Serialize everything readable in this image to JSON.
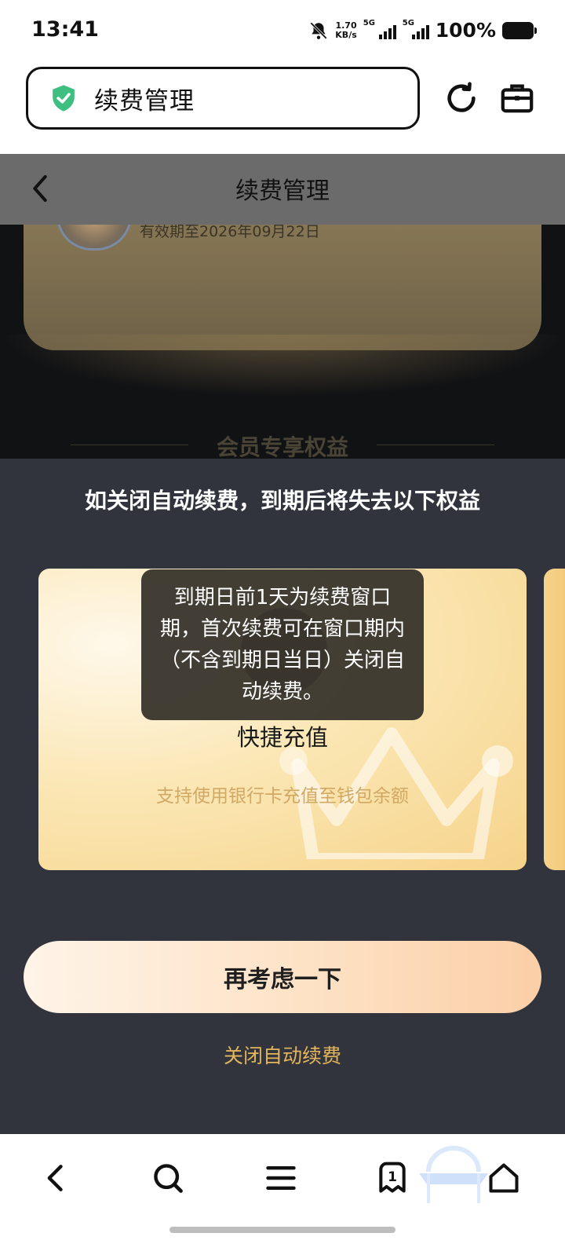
{
  "status_bar": {
    "time": "13:41",
    "net_speed_value": "1.70",
    "net_speed_unit": "KB/s",
    "sim1": "5G",
    "sim2": "5G",
    "battery": "100%"
  },
  "browser": {
    "address_title": "续费管理",
    "refresh_icon": "refresh-icon",
    "toolbox_icon": "briefcase-icon",
    "tab_count": "1"
  },
  "page": {
    "header_title": "续费管理",
    "expiry_text": "有效期至2026年09月22日",
    "benefits_heading": "会员专享权益"
  },
  "sheet": {
    "heading": "如关闭自动续费，到期后将失去以下权益",
    "card": {
      "title": "快捷充值",
      "description": "支持使用银行卡充值至钱包余额"
    },
    "tooltip": "到期日前1天为续费窗口期，首次续费可在窗口期内（不含到期日当日）关闭自动续费。",
    "primary_button": "再考虑一下",
    "close_link": "关闭自动续费"
  },
  "colors": {
    "sheet_bg": "#31343c",
    "accent_gold": "#e4b55a",
    "card_desc": "#d2a865",
    "secure_green": "#3fbf7f"
  }
}
